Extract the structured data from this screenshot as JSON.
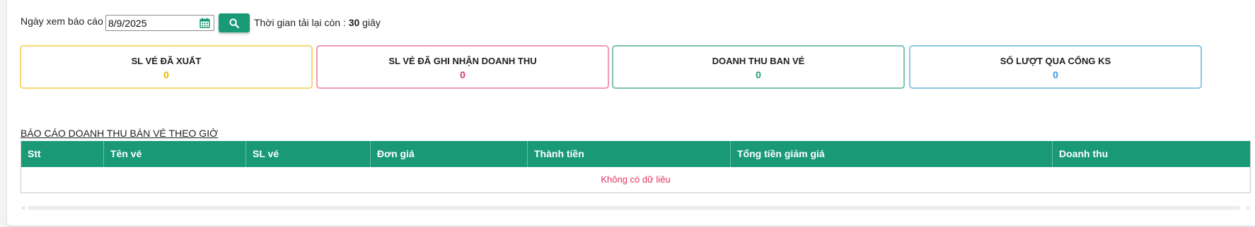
{
  "filter": {
    "label": "Ngày xem báo cáo",
    "date_value": "8/9/2025",
    "search_icon": "search-icon",
    "calendar_icon": "calendar-icon",
    "reload_prefix": "Thời gian tải lại còn :",
    "reload_seconds": "30",
    "reload_unit": "giây"
  },
  "cards": [
    {
      "title": "SL VÉ ĐÃ XUẤT",
      "value": "0",
      "border_color": "#f5d76e",
      "value_color": "#f0b400"
    },
    {
      "title": "SL VÉ ĐÃ GHI NHẬN DOANH THU",
      "value": "0",
      "border_color": "#f29ab1",
      "value_color": "#e0345d"
    },
    {
      "title": "DOANH THU BAN VÉ",
      "value": "0",
      "border_color": "#7cc3b3",
      "value_color": "#1a9977"
    },
    {
      "title": "SỐ LƯỢT QUA CỔNG KS",
      "value": "0",
      "border_color": "#8ec5e6",
      "value_color": "#2a9fd6"
    }
  ],
  "report": {
    "title": "BÁO CÁO DOANH THU BÁN VÉ THEO GIỜ",
    "columns": [
      "Stt",
      "Tên vé",
      "SL vé",
      "Đơn giá",
      "Thành tiền",
      "Tổng tiền giảm giá",
      "Doanh thu"
    ],
    "empty_message": "Không có dữ liêu"
  },
  "colors": {
    "accent": "#1a9977",
    "empty_text": "#e0345d"
  }
}
